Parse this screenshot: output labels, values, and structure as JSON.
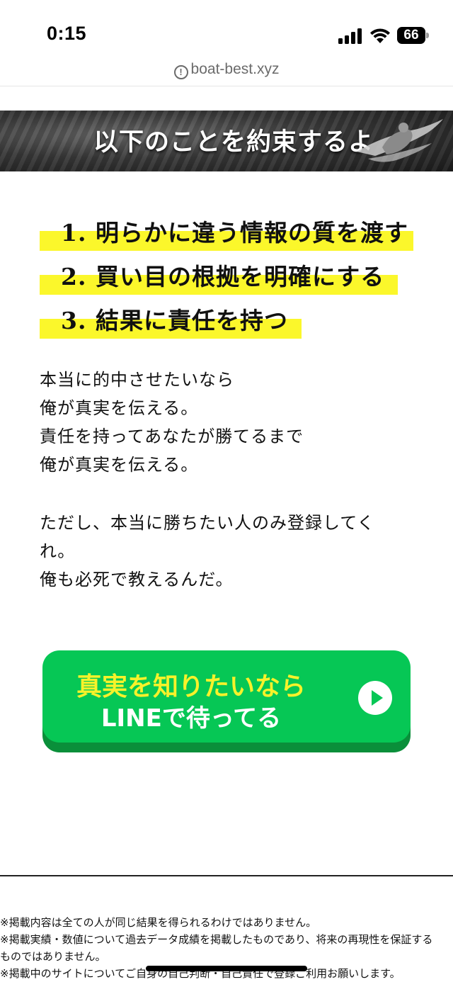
{
  "status_bar": {
    "time": "0:15",
    "battery": "66"
  },
  "url_bar": {
    "url": "boat-best.xyz",
    "info_icon": "!"
  },
  "banner": {
    "title": "以下のことを約束するよ"
  },
  "promises": [
    "1. 明らかに違う情報の質を渡す",
    "2. 買い目の根拠を明確にする",
    "3. 結果に責任を持つ"
  ],
  "body": {
    "paragraph1": [
      "本当に的中させたいなら",
      "俺が真実を伝える。",
      "責任を持ってあなたが勝てるまで",
      "俺が真実を伝える。"
    ],
    "paragraph2": [
      "ただし、本当に勝ちたい人のみ登録してく",
      "れ。",
      "俺も必死で教えるんだ。"
    ]
  },
  "cta": {
    "line1": "真実を知りたいなら",
    "line2": "LINEで待ってる",
    "colors": {
      "button": "#06c755",
      "highlight_text": "#f7f22a"
    }
  },
  "footer": {
    "notes": [
      "※掲載内容は全ての人が同じ結果を得られるわけではありません。",
      "※掲載実績・数値について過去データ成績を掲載したものであり、将来の再現性を保証する",
      "ものではありません。",
      "※掲載中のサイトについてご自身の自己判断・自己責任で登録ご利用お願いします。"
    ]
  },
  "colors": {
    "highlight": "#fbf72b",
    "banner_bg": "#3a3a3a"
  }
}
